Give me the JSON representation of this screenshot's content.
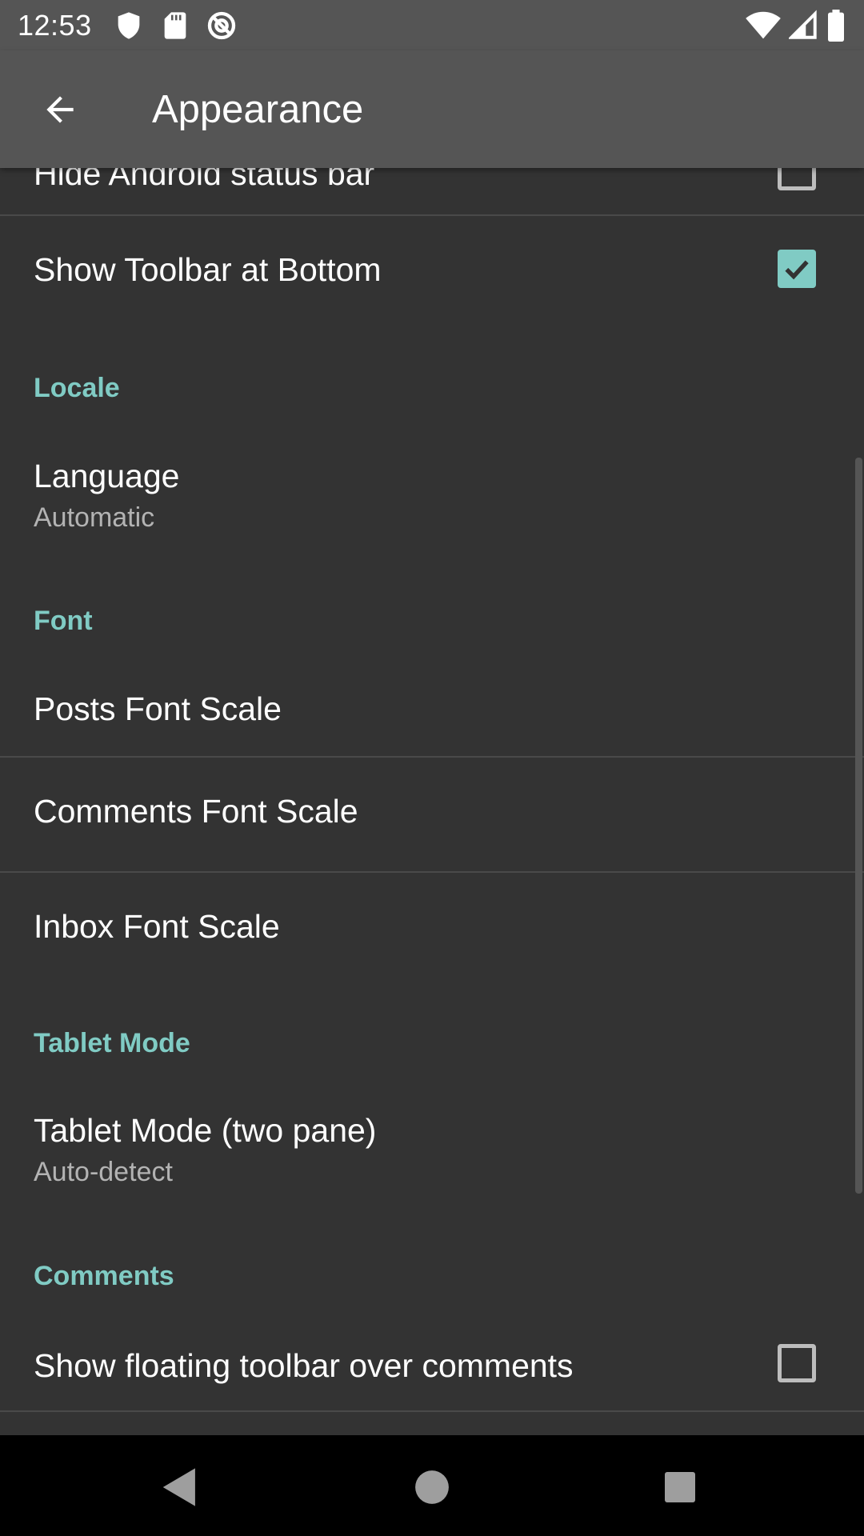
{
  "status_bar": {
    "time": "12:53",
    "icons_left": [
      "shield-icon",
      "sd-card-icon",
      "at-sign-icon"
    ],
    "icons_right": [
      "wifi-icon",
      "signal-icon",
      "battery-icon"
    ]
  },
  "app_bar": {
    "title": "Appearance",
    "back_icon": "arrow-back-icon"
  },
  "settings": {
    "hide_status_bar": {
      "label": "Hide Android status bar",
      "checked": false
    },
    "show_toolbar_bottom": {
      "label": "Show Toolbar at Bottom",
      "checked": true
    },
    "locale_header": "Locale",
    "language": {
      "label": "Language",
      "value": "Automatic"
    },
    "font_header": "Font",
    "posts_font_scale": {
      "label": "Posts Font Scale"
    },
    "comments_font_scale": {
      "label": "Comments Font Scale"
    },
    "inbox_font_scale": {
      "label": "Inbox Font Scale"
    },
    "tablet_header": "Tablet Mode",
    "tablet_mode": {
      "label": "Tablet Mode (two pane)",
      "value": "Auto-detect"
    },
    "comments_header": "Comments",
    "floating_toolbar": {
      "label": "Show floating toolbar over comments",
      "checked": false
    }
  },
  "colors": {
    "accent": "#80cbc4",
    "background": "#333333",
    "app_bar": "#555555"
  },
  "nav_bar": {
    "icons": [
      "nav-back-icon",
      "nav-home-icon",
      "nav-recents-icon"
    ]
  }
}
